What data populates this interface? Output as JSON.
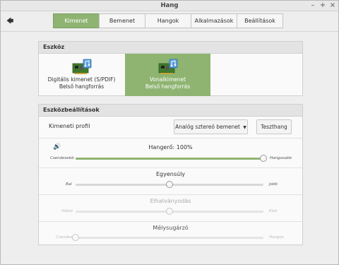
{
  "window": {
    "title": "Hang"
  },
  "toolbar": {
    "tabs": [
      "Kimenet",
      "Bemenet",
      "Hangok",
      "Alkalmazások",
      "Beállítások"
    ],
    "active_tab": "Kimenet"
  },
  "device_section": {
    "title": "Eszköz",
    "devices": [
      {
        "line1": "Digitális kimenet (S/PDIF)",
        "line2": "Belső hangforrás",
        "selected": false
      },
      {
        "line1": "Vonalkimenet",
        "line2": "Belső hangforrás",
        "selected": true
      }
    ]
  },
  "settings_section": {
    "title": "Eszközbeállítások",
    "profile_label": "Kimeneti profil",
    "profile_value": "Analóg sztereó bemenet",
    "test_button": "Teszthang",
    "volume": {
      "title": "Hangerő: 100%",
      "min_label": "Csendesebb",
      "max_label": "Hangosabb",
      "value": 1.0
    },
    "balance": {
      "title": "Egyensúly",
      "min_label": "Bal",
      "max_label": "Jobb",
      "value": 0.5
    },
    "fade": {
      "title": "Elhalványodás",
      "min_label": "Hátsó",
      "max_label": "Elsõ",
      "value": 0.5
    },
    "subwoofer": {
      "title": "Mélysugárzó",
      "min_label": "Csendes",
      "max_label": "Hangos",
      "value": 0.0
    }
  }
}
